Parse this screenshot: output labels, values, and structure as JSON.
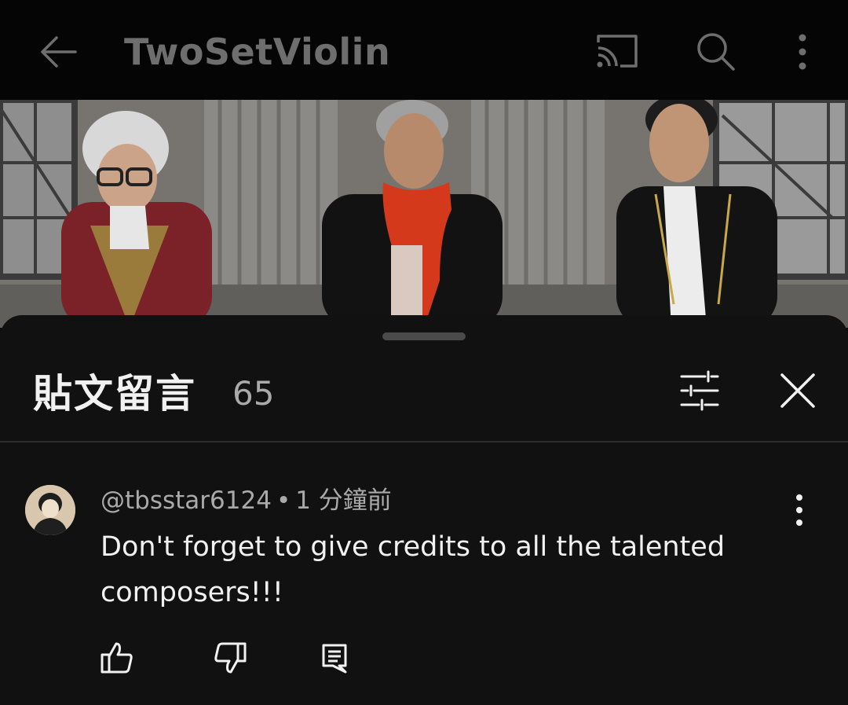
{
  "header": {
    "channel_name": "TwoSetViolin",
    "icons": {
      "back": "arrow-left-icon",
      "cast": "cast-icon",
      "search": "search-icon",
      "more": "more-vertical-icon"
    }
  },
  "comments_panel": {
    "title": "貼文留言",
    "count": "65",
    "icons": {
      "filter": "sliders-icon",
      "close": "close-icon"
    }
  },
  "comments": [
    {
      "author": "@tbsstar6124",
      "separator": "•",
      "time": "1 分鐘前",
      "text": "Don't forget to give credits to all the talented composers!!!",
      "icons": {
        "avatar": "avatar-image",
        "more": "more-vertical-icon",
        "like": "thumbs-up-icon",
        "dislike": "thumbs-down-icon",
        "reply": "reply-comment-icon"
      }
    }
  ],
  "colors": {
    "background": "#0f0f0f",
    "sheet": "#111111",
    "primary_text": "#f1f1f1",
    "secondary_text": "#aaaaaa"
  }
}
